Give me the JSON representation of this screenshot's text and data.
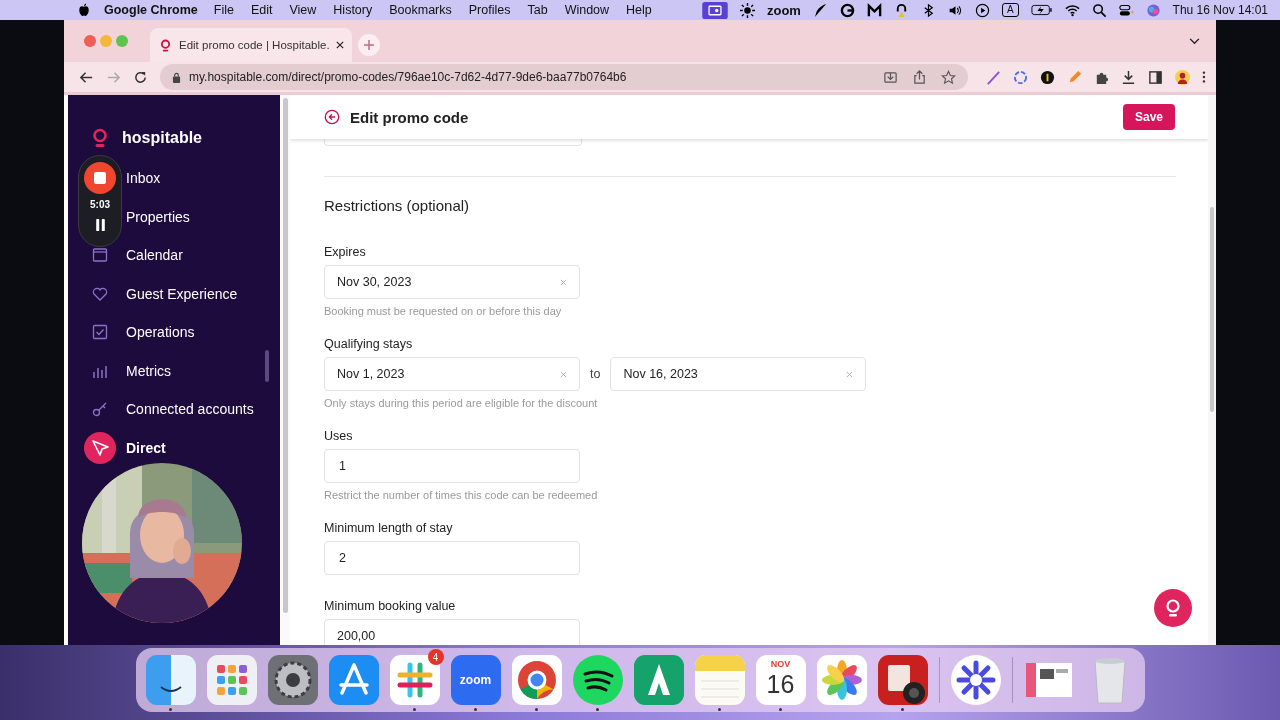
{
  "menu_bar": {
    "app": "Google Chrome",
    "menus": [
      "File",
      "Edit",
      "View",
      "History",
      "Bookmarks",
      "Profiles",
      "Tab",
      "Window",
      "Help"
    ],
    "zoom_label": "zoom",
    "input_source": "A",
    "clock": "Thu 16 Nov  14:01"
  },
  "browser": {
    "tabs": [
      {
        "title": "Edit promo code | Hospitable.",
        "selected": true
      }
    ],
    "url": "my.hospitable.com/direct/promo-codes/796ae10c-7d62-4d77-9de6-baa77b0764b6"
  },
  "sidebar": {
    "brand": "hospitable",
    "items": [
      {
        "label": "Inbox",
        "selected": false
      },
      {
        "label": "Properties",
        "selected": false
      },
      {
        "label": "Calendar",
        "selected": false
      },
      {
        "label": "Guest Experience",
        "selected": false
      },
      {
        "label": "Operations",
        "selected": false
      },
      {
        "label": "Metrics",
        "selected": false
      },
      {
        "label": "Connected accounts",
        "selected": false
      },
      {
        "label": "Direct",
        "selected": true
      }
    ]
  },
  "recorder": {
    "time": "5:03"
  },
  "header": {
    "title": "Edit promo code",
    "save": "Save"
  },
  "form": {
    "section_title": "Restrictions (optional)",
    "fields": [
      {
        "kind": "date",
        "label": "Expires",
        "value": "Nov 30, 2023",
        "hint": "Booking must be requested on or before this day"
      },
      {
        "kind": "date_range",
        "label": "Qualifying stays",
        "from": "Nov 1, 2023",
        "separator": "to",
        "to": "Nov 16, 2023",
        "hint": "Only stays during this period are eligible for the discount"
      },
      {
        "kind": "text",
        "label": "Uses",
        "value": "1",
        "hint": "Restrict the number of times this code can be redeemed"
      },
      {
        "kind": "text",
        "label": "Minimum length of stay",
        "value": "2"
      },
      {
        "kind": "text",
        "label": "Minimum booking value",
        "value": "200,00"
      }
    ]
  },
  "dock": {
    "items": [
      {
        "kind": "finder",
        "running": true
      },
      {
        "kind": "launchpad",
        "running": false
      },
      {
        "kind": "settings",
        "running": false
      },
      {
        "kind": "appstore",
        "running": false
      },
      {
        "kind": "slack",
        "running": true,
        "badge": "4"
      },
      {
        "kind": "zoom",
        "running": true,
        "label": "zoom"
      },
      {
        "kind": "chrome",
        "running": true
      },
      {
        "kind": "spotify",
        "running": true
      },
      {
        "kind": "a-app",
        "running": false
      },
      {
        "kind": "notes",
        "running": true
      },
      {
        "kind": "calendar",
        "running": true,
        "month": "NOV",
        "day": "16"
      },
      {
        "kind": "photos",
        "running": false
      },
      {
        "kind": "photobooth",
        "running": true
      },
      {
        "kind": "separator"
      },
      {
        "kind": "asterisk",
        "running": false
      },
      {
        "kind": "separator"
      },
      {
        "kind": "window-thumb",
        "running": false
      },
      {
        "kind": "trash",
        "running": false
      }
    ]
  }
}
